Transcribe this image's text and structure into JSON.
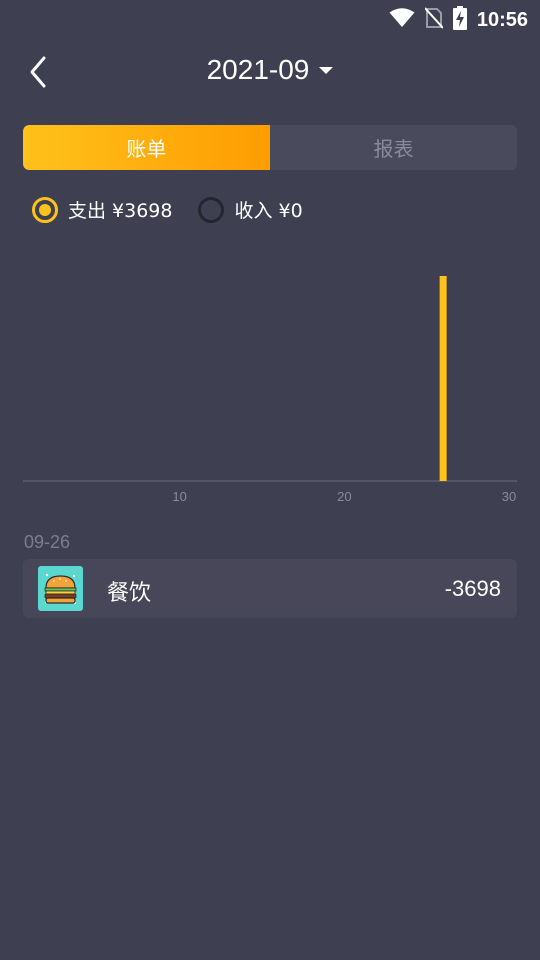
{
  "status_bar": {
    "time": "10:56",
    "icons": [
      "wifi-icon",
      "no-sim-icon",
      "battery-charging-icon"
    ]
  },
  "header": {
    "back_icon": "chevron-left-icon",
    "month": "2021-09",
    "dropdown_icon": "caret-down-icon"
  },
  "tabs": [
    {
      "label": "账单",
      "active": true
    },
    {
      "label": "报表",
      "active": false
    }
  ],
  "filters": [
    {
      "label": "支出 ¥3698",
      "selected": true
    },
    {
      "label": "收入 ¥0",
      "selected": false
    }
  ],
  "chart_data": {
    "type": "bar",
    "x": [
      26
    ],
    "values": [
      3698
    ],
    "xticks": [
      "10",
      "20",
      "30"
    ],
    "xlim": [
      0,
      30
    ],
    "ylim": [
      0,
      3698
    ],
    "grid": false,
    "color": "#ffc21a"
  },
  "records": {
    "date": "09-26",
    "items": [
      {
        "icon": "burger-icon",
        "category": "餐饮",
        "amount": "-3698"
      }
    ]
  },
  "colors": {
    "background": "#3f3f52",
    "accent": "#ffc21a",
    "accent_end": "#ff9c00",
    "card": "#474759",
    "muted": "#7d7d90"
  }
}
